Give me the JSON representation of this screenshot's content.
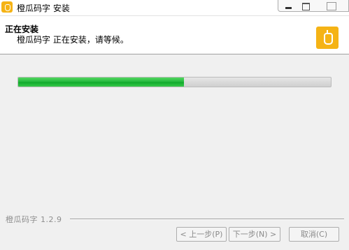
{
  "window": {
    "title": "橙瓜码字 安装",
    "icon": "app-logo-icon"
  },
  "header": {
    "title": "正在安装",
    "subtitle": "橙瓜码字 正在安装，请等候。",
    "logo": "app-logo-icon"
  },
  "progress": {
    "value": 0.53,
    "color": "#22b63c"
  },
  "footer": {
    "version": "橙瓜码字 1.2.9"
  },
  "buttons": {
    "back": "< 上一步(P)",
    "next": "下一步(N) >",
    "cancel": "取消(C)"
  },
  "colors": {
    "accent": "#f5b315",
    "disabled_text": "#8a8a8a"
  }
}
